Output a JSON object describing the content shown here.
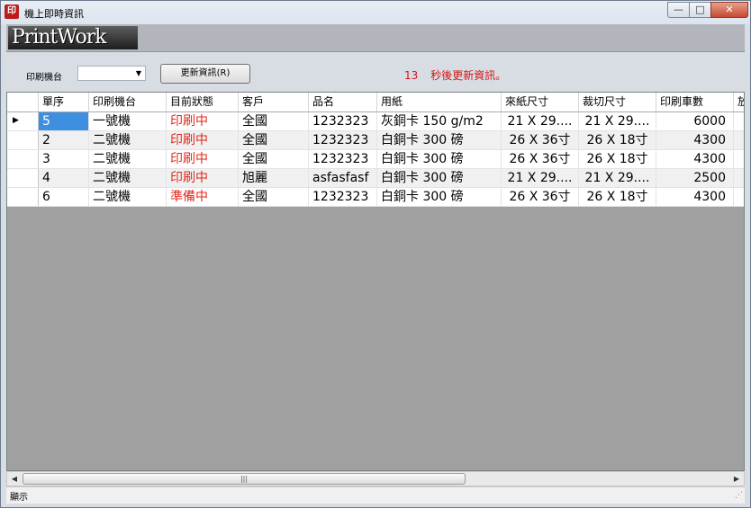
{
  "window": {
    "title": "機上即時資訊",
    "app_icon": "app-logo-icon",
    "controls": {
      "minimize": "—",
      "maximize": "□",
      "close": "✕"
    }
  },
  "logo": {
    "text": "PrintWork"
  },
  "toolbar": {
    "printer_label": "印刷機台",
    "printer_value": "",
    "refresh_label": "更新資訊(R)",
    "countdown_value": "13",
    "countdown_text": "秒後更新資訊。"
  },
  "table": {
    "columns": [
      "單序",
      "印刷機台",
      "目前狀態",
      "客戶",
      "品名",
      "用紙",
      "來紙尺寸",
      "裁切尺寸",
      "印刷車數",
      "放"
    ],
    "rows": [
      {
        "seq": "5",
        "machine": "一號機",
        "status": "印刷中",
        "customer": "全國",
        "product": "1232323",
        "paper": "灰銅卡 150 g/m2",
        "in_size": "21 X 29....",
        "cut_size": "21 X 29....",
        "count": "6000"
      },
      {
        "seq": "2",
        "machine": "二號機",
        "status": "印刷中",
        "customer": "全國",
        "product": "1232323",
        "paper": "白銅卡 300 磅",
        "in_size": "26 X 36寸",
        "cut_size": "26 X 18寸",
        "count": "4300"
      },
      {
        "seq": "3",
        "machine": "二號機",
        "status": "印刷中",
        "customer": "全國",
        "product": "1232323",
        "paper": "白銅卡 300 磅",
        "in_size": "26 X 36寸",
        "cut_size": "26 X 18寸",
        "count": "4300"
      },
      {
        "seq": "4",
        "machine": "二號機",
        "status": "印刷中",
        "customer": "旭麗",
        "product": "asfasfasf",
        "paper": "白銅卡 300 磅",
        "in_size": "21 X 29....",
        "cut_size": "21 X 29....",
        "count": "2500"
      },
      {
        "seq": "6",
        "machine": "二號機",
        "status": "準備中",
        "customer": "全國",
        "product": "1232323",
        "paper": "白銅卡 300 磅",
        "in_size": "26 X 36寸",
        "cut_size": "26 X 18寸",
        "count": "4300"
      }
    ]
  },
  "scrollbar": {
    "thumb_grip": "|||",
    "left_arrow": "◀",
    "right_arrow": "▶"
  },
  "status_bar": {
    "text": "顯示",
    "grip": "⋰"
  },
  "colors": {
    "status_text": "#e0281c",
    "selected_cell": "#3f8fe0",
    "countdown": "#d01616"
  }
}
